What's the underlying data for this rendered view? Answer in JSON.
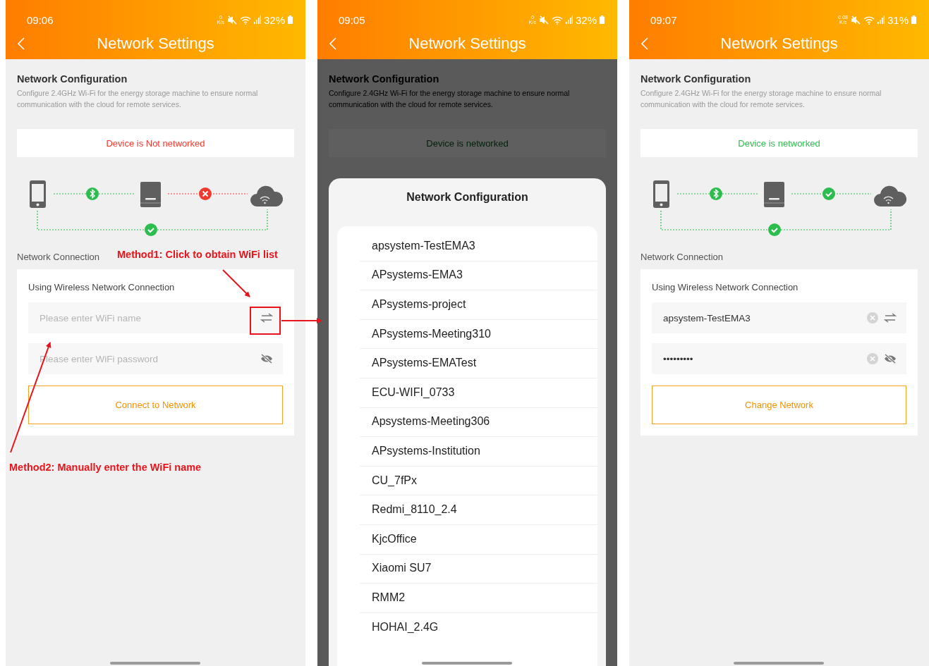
{
  "screens": [
    {
      "kind": "form",
      "status_bar": {
        "time": "09:06",
        "speed": "0",
        "speed_unit": "K/s",
        "battery": "32%"
      },
      "title": "Network Settings",
      "config": {
        "heading": "Network Configuration",
        "description": "Configure 2.4GHz Wi-Fi for the energy storage machine to ensure normal communication with the cloud for remote services."
      },
      "banner": {
        "text": "Device is Not networked",
        "networked": false
      },
      "diagram": {
        "cloud_connected": false
      },
      "connection_label": "Network Connection",
      "card": {
        "title": "Using Wireless Network Connection",
        "fields": [
          {
            "kind": "wifi_name",
            "placeholder": "Please enter WiFi name",
            "clearable": false
          },
          {
            "kind": "password",
            "placeholder": "Please enter WiFi password",
            "clearable": false
          }
        ],
        "button": "Connect to Network"
      }
    },
    {
      "kind": "picker",
      "status_bar": {
        "time": "09:05",
        "speed": "0",
        "speed_unit": "K/s",
        "battery": "32%"
      },
      "title": "Network Settings",
      "config": {
        "heading": "Network Configuration",
        "description": "Configure 2.4GHz Wi-Fi for the energy storage machine to ensure normal communication with the cloud for remote services."
      },
      "banner": {
        "text": "Device is networked",
        "networked": true
      },
      "sheet": {
        "title": "Network Configuration",
        "networks": [
          "apsystem-TestEMA3",
          "APsystems-EMA3",
          "APsystems-project",
          "APsystems-Meeting310",
          "APsystems-EMATest",
          "ECU-WIFI_0733",
          "Apsystems-Meeting306",
          "APsystems-Institution",
          "CU_7fPx",
          "Redmi_8110_2.4",
          "KjcOffice",
          "Xiaomi SU7",
          "RMM2",
          "HOHAI_2.4G"
        ]
      }
    },
    {
      "kind": "form",
      "status_bar": {
        "time": "09:07",
        "speed": "0.08",
        "speed_unit": "K/s",
        "battery": "31%"
      },
      "title": "Network Settings",
      "config": {
        "heading": "Network Configuration",
        "description": "Configure 2.4GHz Wi-Fi for the energy storage machine to ensure normal communication with the cloud for remote services."
      },
      "banner": {
        "text": "Device is networked",
        "networked": true
      },
      "diagram": {
        "cloud_connected": true
      },
      "connection_label": "Network Connection",
      "card": {
        "title": "Using Wireless Network Connection",
        "fields": [
          {
            "kind": "wifi_name",
            "value": "apsystem-TestEMA3",
            "clearable": true
          },
          {
            "kind": "password",
            "value": "•••••••••",
            "clearable": true
          }
        ],
        "button": "Change Network"
      }
    }
  ],
  "annotations": {
    "method1": "Method1: Click to obtain WiFi list",
    "method2": "Method2: Manually enter the WiFi name"
  }
}
